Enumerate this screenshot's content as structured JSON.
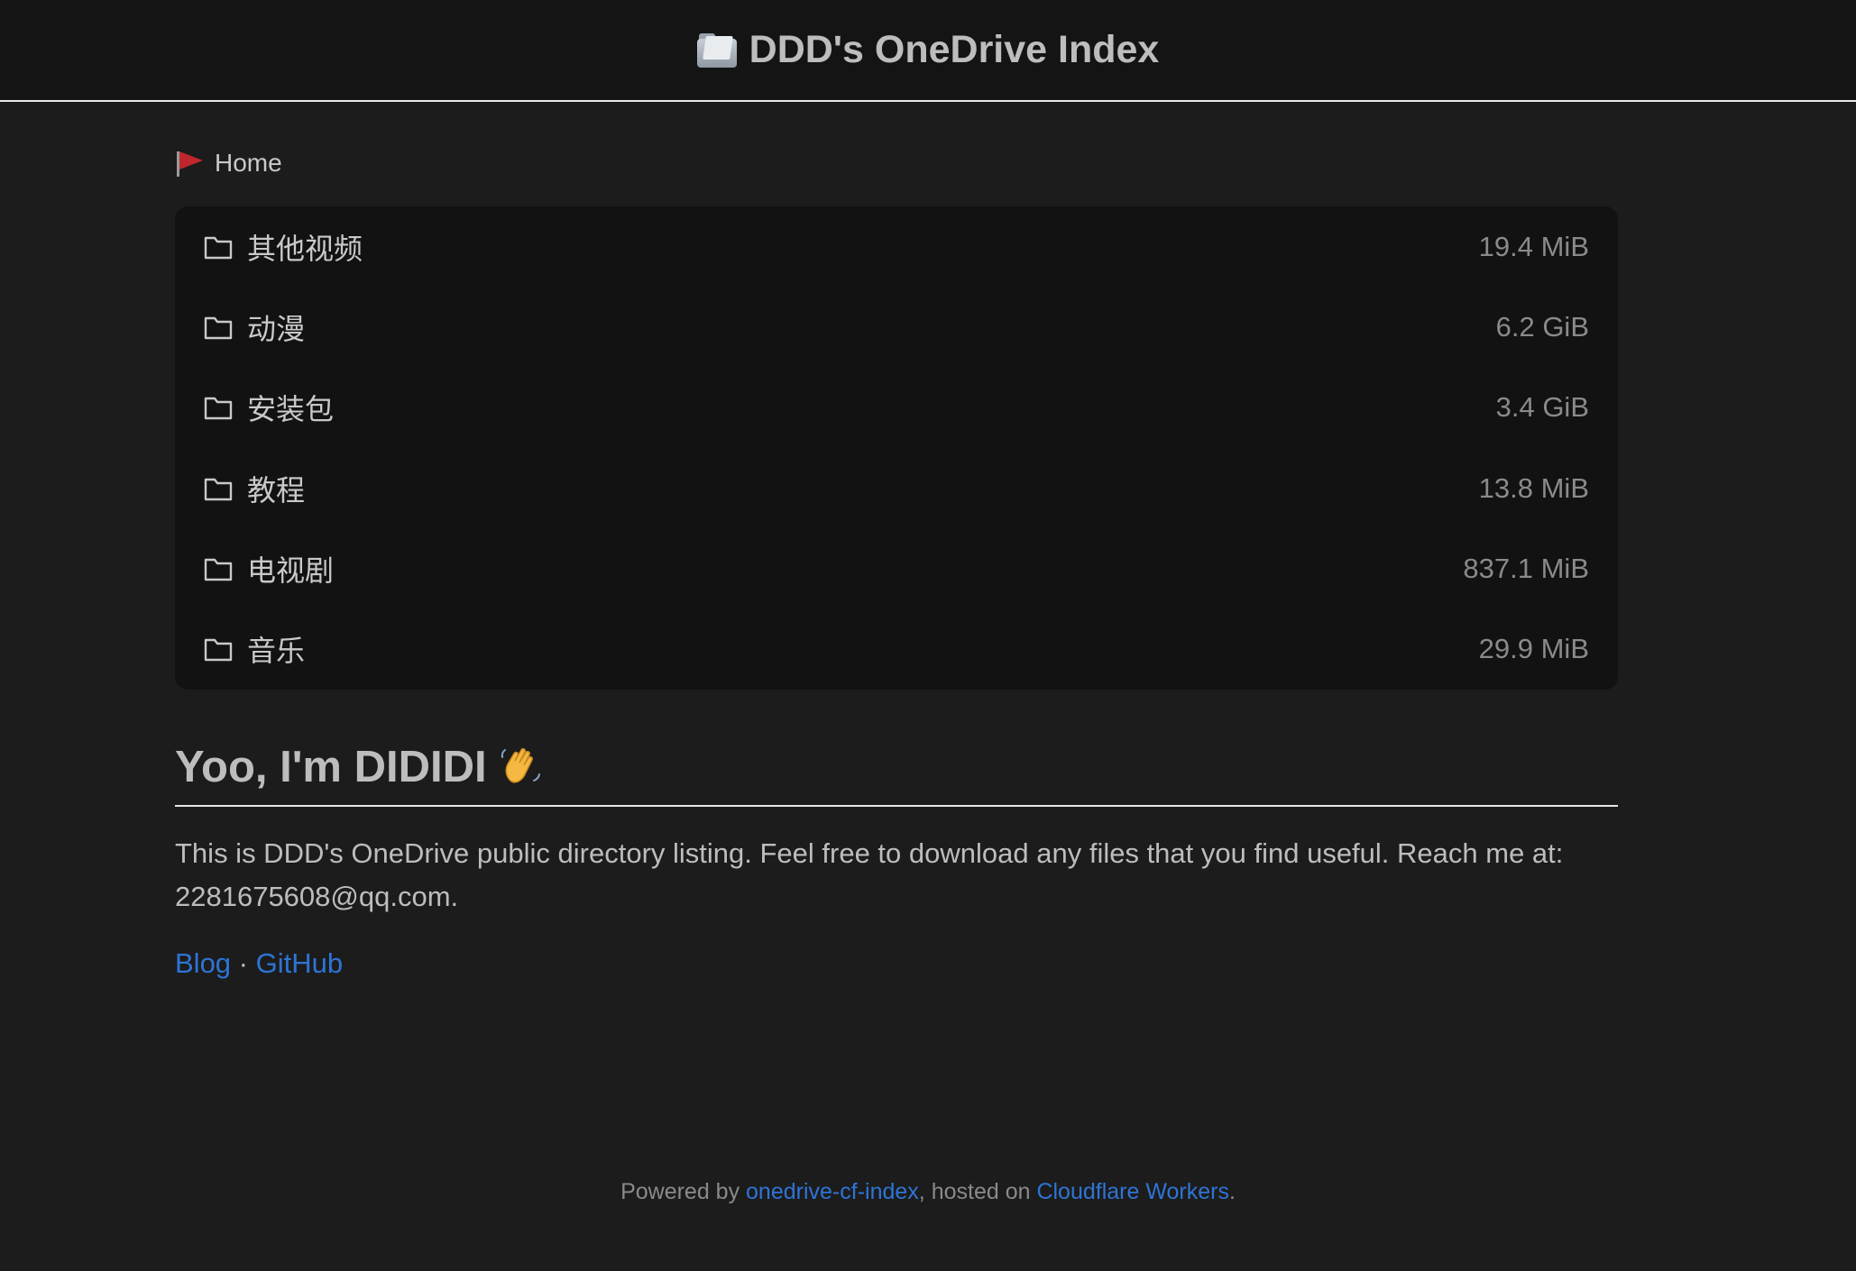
{
  "header": {
    "icon": "folder-emoji-icon",
    "title": "DDD's OneDrive Index"
  },
  "breadcrumb": {
    "icon": "flag-icon",
    "home_label": "Home"
  },
  "files": [
    {
      "icon": "folder-icon",
      "name": "其他视频",
      "size": "19.4 MiB"
    },
    {
      "icon": "folder-icon",
      "name": "动漫",
      "size": "6.2 GiB"
    },
    {
      "icon": "folder-icon",
      "name": "安装包",
      "size": "3.4 GiB"
    },
    {
      "icon": "folder-icon",
      "name": "教程",
      "size": "13.8 MiB"
    },
    {
      "icon": "folder-icon",
      "name": "电视剧",
      "size": "837.1 MiB"
    },
    {
      "icon": "folder-icon",
      "name": "音乐",
      "size": "29.9 MiB"
    }
  ],
  "readme": {
    "title": "Yoo, I'm DIDIDI",
    "title_icon": "waving-hand-icon",
    "body": "This is DDD's OneDrive public directory listing. Feel free to download any files that you find useful. Reach me at: 2281675608@qq.com.",
    "links": {
      "blog": "Blog",
      "separator": "·",
      "github": "GitHub"
    }
  },
  "footer": {
    "prefix": "Powered by ",
    "project_link": "onedrive-cf-index",
    "middle": ", hosted on ",
    "host_link": "Cloudflare Workers",
    "suffix": "."
  },
  "colors": {
    "background": "#1c1c1c",
    "header_background": "#141414",
    "list_background": "#121212",
    "link": "#2f74d6",
    "text": "#c9c9c9",
    "muted": "#8a8a8a"
  }
}
